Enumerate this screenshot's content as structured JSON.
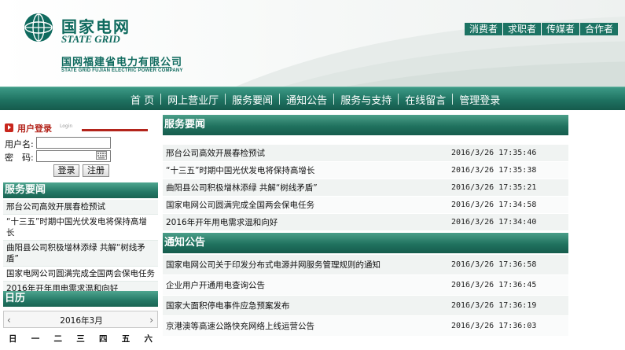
{
  "header": {
    "brand_cn": "国家电网",
    "brand_en": "STATE GRID",
    "company_cn": "国网福建省电力有限公司",
    "company_en": "STATE GRID FUJIAN ELECTRIC POWER COMPANY",
    "portal_links": [
      "消费者",
      "求职者",
      "传媒者",
      "合作者"
    ]
  },
  "nav": {
    "items": [
      "首 页",
      "网上营业厅",
      "服务要闻",
      "通知公告",
      "服务与支持",
      "在线留言",
      "管理登录"
    ]
  },
  "login": {
    "title": "用户登录",
    "title_en": "Login",
    "username_label": "用户名:",
    "password_label": "密　码:",
    "username_value": "",
    "password_value": "",
    "login_button": "登录",
    "register_button": "注册"
  },
  "side_news": {
    "title": "服务要闻",
    "items": [
      "邢台公司高效开展春检预试",
      "“十三五”时期中国光伏发电将保持高增长",
      "曲阳县公司积极增林添绿 共解“树线矛盾”",
      "国家电网公司圆满完成全国两会保电任务",
      "2016年开年用电需求温和向好"
    ]
  },
  "calendar": {
    "title": "日历",
    "month": "2016年3月",
    "weekdays": [
      "日",
      "一",
      "二",
      "三",
      "四",
      "五",
      "六"
    ]
  },
  "news": {
    "title": "服务要闻",
    "rows": [
      {
        "title": "邢台公司高效开展春检预试",
        "date": "2016/3/26 17:35:46"
      },
      {
        "title": "“十三五”时期中国光伏发电将保持高增长",
        "date": "2016/3/26 17:35:38"
      },
      {
        "title": "曲阳县公司积极增林添绿 共解“树线矛盾”",
        "date": "2016/3/26 17:35:21"
      },
      {
        "title": "国家电网公司圆满完成全国两会保电任务",
        "date": "2016/3/26 17:34:58"
      },
      {
        "title": "2016年开年用电需求温和向好",
        "date": "2016/3/26 17:34:40"
      }
    ]
  },
  "notices": {
    "title": "通知公告",
    "rows": [
      {
        "title": "国家电网公司关于印发分布式电源并网服务管理规则的通知",
        "date": "2016/3/26 17:36:58"
      },
      {
        "title": "企业用户开通用电查询公告",
        "date": "2016/3/26 17:36:45"
      },
      {
        "title": "国家大面积停电事件应急预案发布",
        "date": "2016/3/26 17:36:19"
      },
      {
        "title": "京港澳等高速公路快充网络上线运营公告",
        "date": "2016/3/26 17:36:03"
      }
    ]
  },
  "colors": {
    "brand_green": "#0f6a5e",
    "nav_green": "#1f7362",
    "login_red": "#b3241b"
  }
}
